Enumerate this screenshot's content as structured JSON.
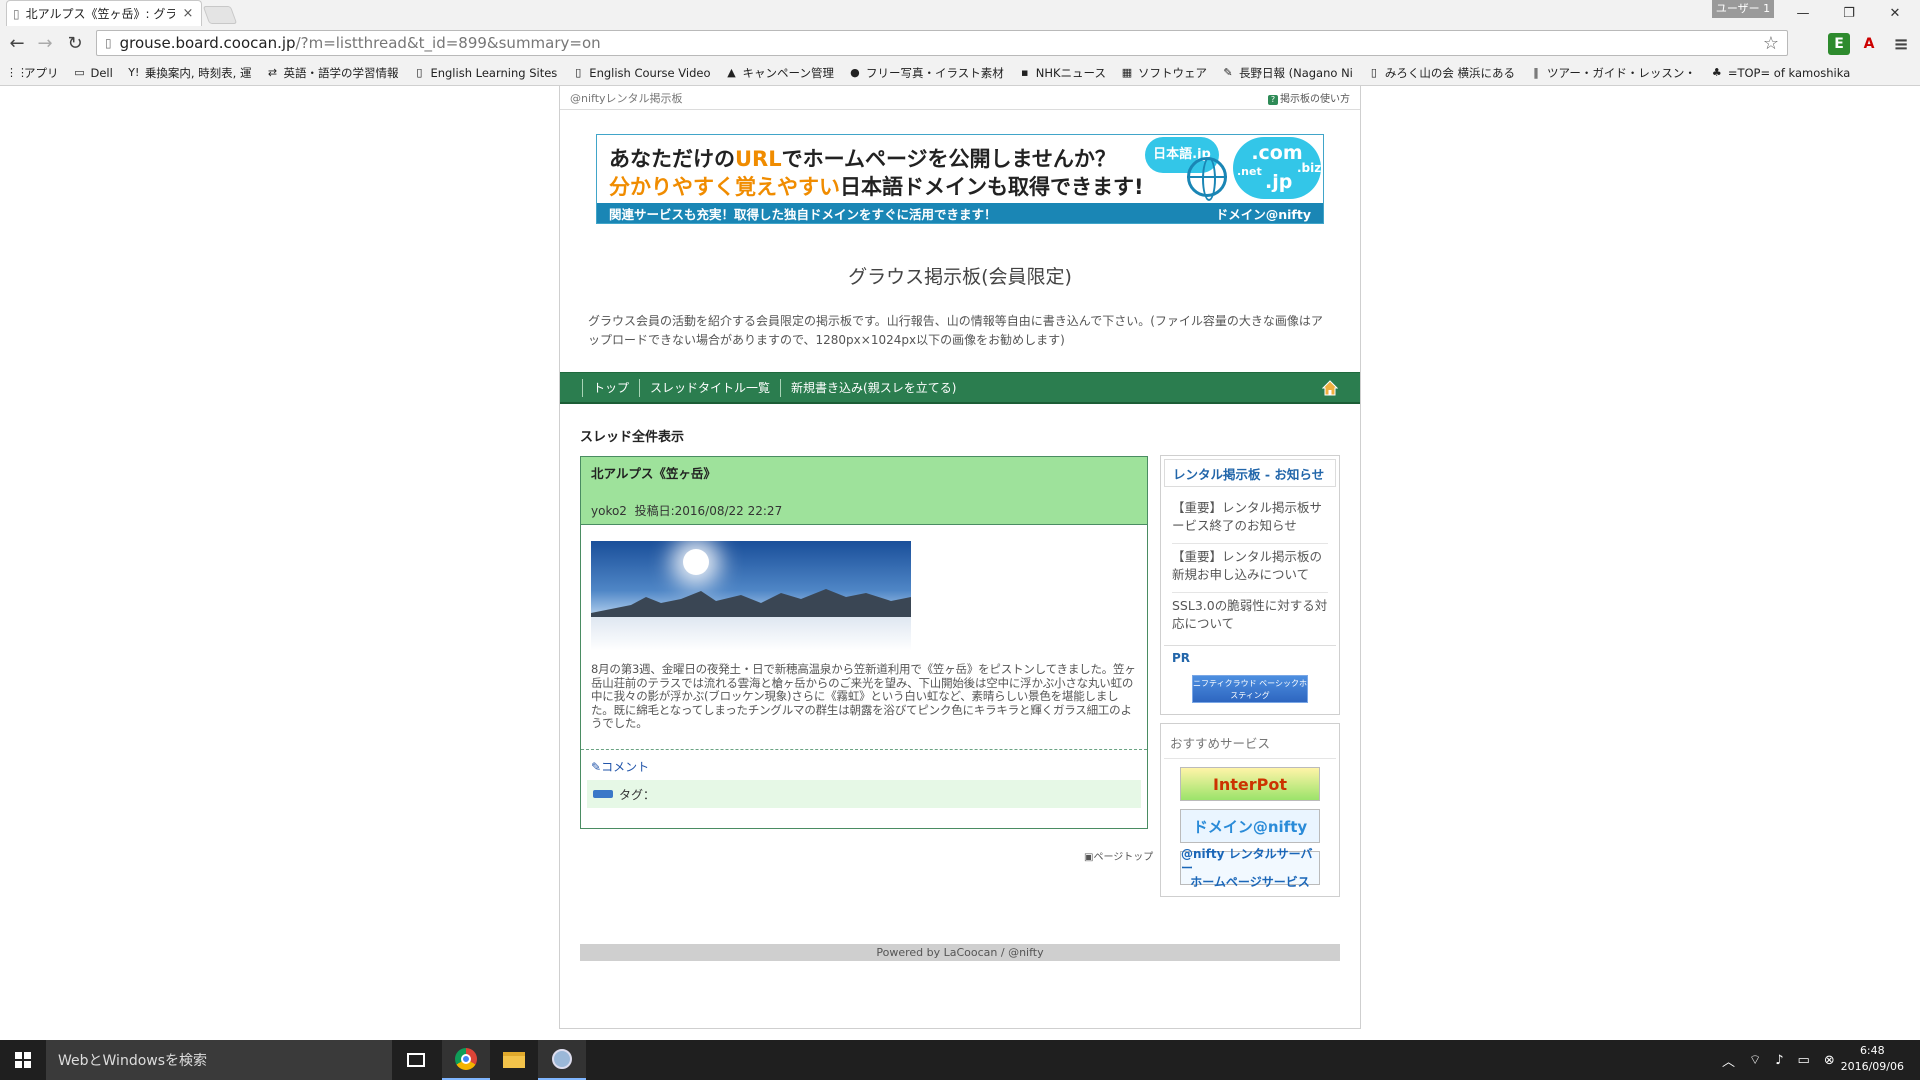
{
  "browser": {
    "tab_title": "北アルプス《笠ヶ岳》: グラウ",
    "tab_close": "×",
    "user_label": "ユーザー 1",
    "window_controls": {
      "minimize": "—",
      "restore": "❐",
      "close": "✕"
    },
    "url_host": "grouse.board.coocan.jp",
    "url_path": "/?m=listthread&t_id=899&summary=on",
    "nav": {
      "back": "←",
      "forward": "→",
      "reload": "↻"
    },
    "star": "☆",
    "menu": "≡",
    "bookmarks": [
      {
        "icon": "⋮⋮",
        "label": "アプリ"
      },
      {
        "icon": "▭",
        "label": "Dell"
      },
      {
        "icon": "Y!",
        "label": "乗換案内, 時刻表, 運"
      },
      {
        "icon": "⇄",
        "label": "英語・語学の学習情報"
      },
      {
        "icon": "▯",
        "label": "English Learning Sites"
      },
      {
        "icon": "▯",
        "label": "English Course Video"
      },
      {
        "icon": "▲",
        "label": "キャンペーン管理"
      },
      {
        "icon": "●",
        "label": "フリー写真・イラスト素材"
      },
      {
        "icon": "▪",
        "label": "NHKニュース"
      },
      {
        "icon": "▦",
        "label": "ソフトウェア"
      },
      {
        "icon": "✎",
        "label": "長野日報 (Nagano Ni"
      },
      {
        "icon": "▯",
        "label": "みろく山の会 横浜にある"
      },
      {
        "icon": "‖",
        "label": "ツアー・ガイド・レッスン・"
      },
      {
        "icon": "♣",
        "label": "=TOP= of kamoshika"
      }
    ]
  },
  "board": {
    "header_left": "@niftyレンタル掲示板",
    "header_right": "掲示板の使い方",
    "ad": {
      "line1_a": "あなただけの",
      "line1_b": "URL",
      "line1_c": "でホームページを公開しませんか？",
      "line2_a": "分かりやすく覚えやすい",
      "line2_b": "日本語ドメインも取得できます!",
      "bar_left": "関連サービスも充実！取得した独自ドメインをすぐに活用できます！",
      "bar_right": "ドメイン@nifty",
      "cloud_jp": "日本語.jp",
      "cloud_com": ".com",
      "cloud_net": ".net",
      "cloud_jp2": ".jp",
      "cloud_biz": ".biz"
    },
    "title": "グラウス掲示板(会員限定)",
    "description": "グラウス会員の活動を紹介する会員限定の掲示板です。山行報告、山の情報等自由に書き込んで下さい。(ファイル容量の大きな画像はアップロードできない場合がありますので、1280px×1024px以下の画像をお勧めします)",
    "nav": [
      "トップ",
      "スレッドタイトル一覧",
      "新規書き込み(親スレを立てる)"
    ],
    "section_title": "スレッド全件表示",
    "thread": {
      "title": "北アルプス《笠ヶ岳》",
      "author": "yoko2",
      "date": "投稿日:2016/08/22 22:27",
      "body": "8月の第3週、金曜日の夜発土・日で新穂高温泉から笠新道利用で《笠ヶ岳》をピストンしてきました。笠ヶ岳山荘前のテラスでは流れる雲海と槍ヶ岳からのご来光を望み、下山開始後は空中に浮かぶ小さな丸い虹の中に我々の影が浮かぶ(ブロッケン現象)さらに《霧虹》という白い虹など、素晴らしい景色を堪能しました。既に綿毛となってしまったチングルマの群生は朝露を浴びてピンク色にキラキラと輝くガラス細工のようでした。",
      "comment": "コメント",
      "tags": "タグ："
    },
    "page_top": "ページトップ",
    "side": {
      "notice_head": "レンタル掲示板 - お知らせ",
      "notices": [
        "【重要】レンタル掲示板サービス終了のお知らせ",
        "【重要】レンタル掲示板の新規お申し込みについて",
        "SSL3.0の脆弱性に対する対応について"
      ],
      "pr": "PR",
      "pr_banner": "ニフティクラウド ベーシックホスティング",
      "recommend_head": "おすすめサービス",
      "rec1": "InterPot",
      "rec2": "ドメイン@nifty",
      "rec3_a": "@nifty レンタルサーバー",
      "rec3_b": "ホームページサービス"
    },
    "powered": "Powered by LaCoocan / @nifty"
  },
  "taskbar": {
    "search_placeholder": "WebとWindowsを検索",
    "time": "6:48",
    "date": "2016/09/06"
  }
}
